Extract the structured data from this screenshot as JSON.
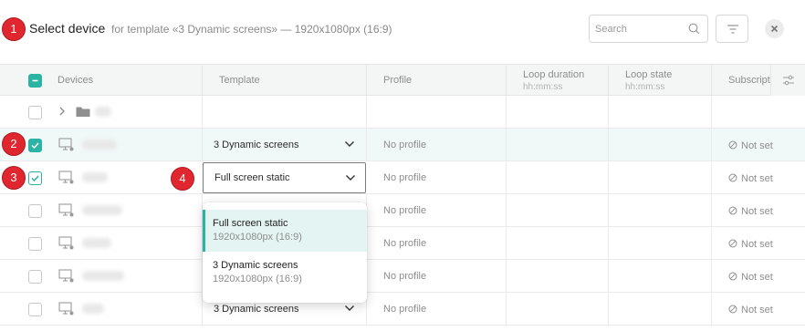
{
  "header": {
    "title": "Select device",
    "subtitle": "for template «3 Dynamic screens» — 1920x1080px (16:9)",
    "search_placeholder": "Search"
  },
  "markers": [
    "1",
    "2",
    "3",
    "4"
  ],
  "columns": {
    "devices": "Devices",
    "template": "Template",
    "profile": "Profile",
    "loop_duration": "Loop duration",
    "loop_duration_unit": "hh:mm:ss",
    "loop_state": "Loop state",
    "loop_state_unit": "hh:mm:ss",
    "subscription": "Subscript"
  },
  "rows": [
    {
      "type": "folder",
      "checked": "unchecked",
      "template": "",
      "profile": "",
      "subscription": ""
    },
    {
      "type": "device",
      "checked": "checked",
      "template": "3 Dynamic screens",
      "profile": "No profile",
      "subscription": "Not set"
    },
    {
      "type": "device",
      "checked": "partial",
      "template": "Full screen static",
      "profile": "No profile",
      "subscription": "Not set"
    },
    {
      "type": "device",
      "checked": "unchecked",
      "template": "",
      "profile": "No profile",
      "subscription": "Not set"
    },
    {
      "type": "device",
      "checked": "unchecked",
      "template": "",
      "profile": "No profile",
      "subscription": "Not set"
    },
    {
      "type": "device",
      "checked": "unchecked",
      "template": "",
      "profile": "No profile",
      "subscription": "Not set"
    },
    {
      "type": "device",
      "checked": "unchecked",
      "template": "3 Dynamic screens",
      "profile": "No profile",
      "subscription": "Not set"
    }
  ],
  "dropdown": {
    "options": [
      {
        "name": "Full screen static",
        "resolution": "1920x1080px (16:9)",
        "selected": true
      },
      {
        "name": "3 Dynamic screens",
        "resolution": "1920x1080px (16:9)",
        "selected": false
      }
    ]
  },
  "colors": {
    "accent": "#2bb3a4",
    "marker": "#e0262e"
  },
  "icons": [
    "search-icon",
    "filter-icon",
    "close-icon",
    "column-settings-icon",
    "chevron-right-icon",
    "folder-icon",
    "monitor-icon",
    "chevron-down-icon",
    "not-set-icon"
  ]
}
